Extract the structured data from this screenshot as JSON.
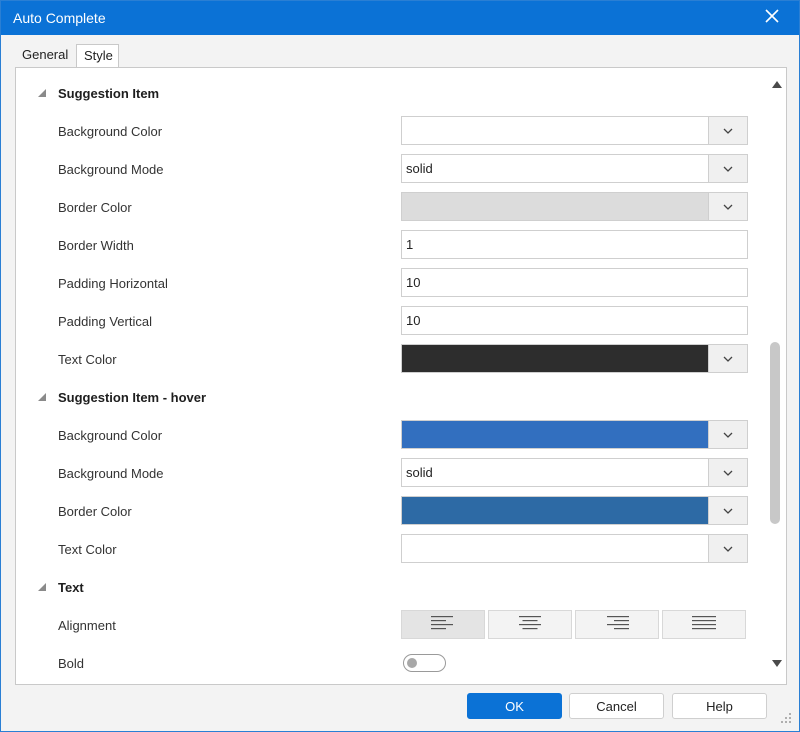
{
  "window": {
    "title": "Auto Complete"
  },
  "tabs": [
    {
      "label": "General",
      "active": false
    },
    {
      "label": "Style",
      "active": true
    }
  ],
  "sections": [
    {
      "title": "Suggestion Item",
      "properties": [
        {
          "label": "Background Color",
          "kind": "color",
          "color": "#ffffff"
        },
        {
          "label": "Background Mode",
          "kind": "select",
          "value": "solid"
        },
        {
          "label": "Border Color",
          "kind": "color",
          "color": "#dcdcdc"
        },
        {
          "label": "Border Width",
          "kind": "text",
          "value": "1"
        },
        {
          "label": "Padding Horizontal",
          "kind": "text",
          "value": "10"
        },
        {
          "label": "Padding Vertical",
          "kind": "text",
          "value": "10"
        },
        {
          "label": "Text Color",
          "kind": "color",
          "color": "#2d2d2d"
        }
      ]
    },
    {
      "title": "Suggestion Item - hover",
      "properties": [
        {
          "label": "Background Color",
          "kind": "color",
          "color": "#326fbf"
        },
        {
          "label": "Background Mode",
          "kind": "select",
          "value": "solid"
        },
        {
          "label": "Border Color",
          "kind": "color",
          "color": "#2d6aa5"
        },
        {
          "label": "Text Color",
          "kind": "color",
          "color": "#ffffff"
        }
      ]
    },
    {
      "title": "Text",
      "properties": [
        {
          "label": "Alignment",
          "kind": "alignment",
          "options": [
            "align-left-icon",
            "align-center-icon",
            "align-right-icon",
            "align-justify-icon"
          ],
          "selected": 0
        },
        {
          "label": "Bold",
          "kind": "toggle",
          "on": false
        }
      ]
    }
  ],
  "buttons": {
    "ok": "OK",
    "cancel": "Cancel",
    "help": "Help"
  },
  "colors": {
    "accent": "#0b72d6"
  }
}
